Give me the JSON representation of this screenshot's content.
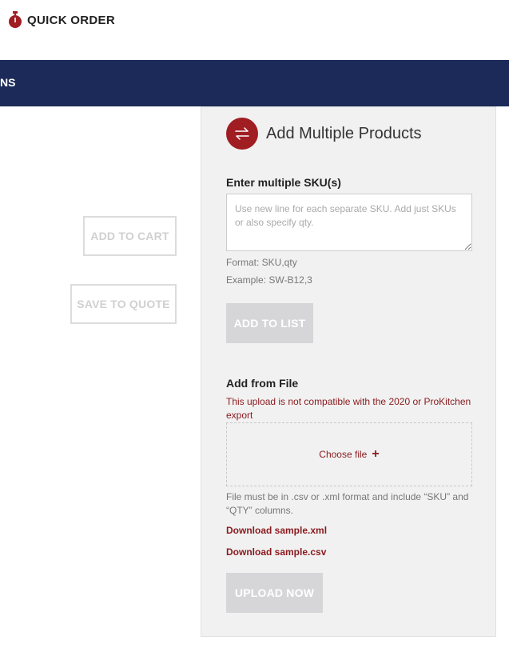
{
  "header": {
    "title": "QUICK ORDER",
    "icon": "stopwatch-icon",
    "nav_fragment": "NS"
  },
  "actions": {
    "add_to_cart": "ADD TO CART",
    "save_to_quote": "SAVE TO QUOTE"
  },
  "panel": {
    "title": "Add Multiple Products",
    "icon": "swap-arrows-icon",
    "sku_label": "Enter multiple SKU(s)",
    "sku_placeholder": "Use new line for each separate SKU. Add just SKUs or also specify qty.",
    "sku_value": "",
    "format_hint": "Format: SKU,qty",
    "example_hint": "Example: SW-B12,3",
    "add_to_list": "ADD TO LIST",
    "file_label": "Add from File",
    "warning": "This upload is not compatible with the 2020 or ProKitchen export",
    "choose_file": "Choose file",
    "file_note": "File must be in .csv or .xml format and include “SKU” and “QTY” columns.",
    "download_xml": "Download sample.xml",
    "download_csv": "Download sample.csv",
    "upload_now": "UPLOAD NOW"
  },
  "colors": {
    "brand_red": "#a01d22",
    "nav_blue": "#1b2a58",
    "link_red": "#8a1a1e",
    "disabled_grey": "#d6d6d8"
  }
}
